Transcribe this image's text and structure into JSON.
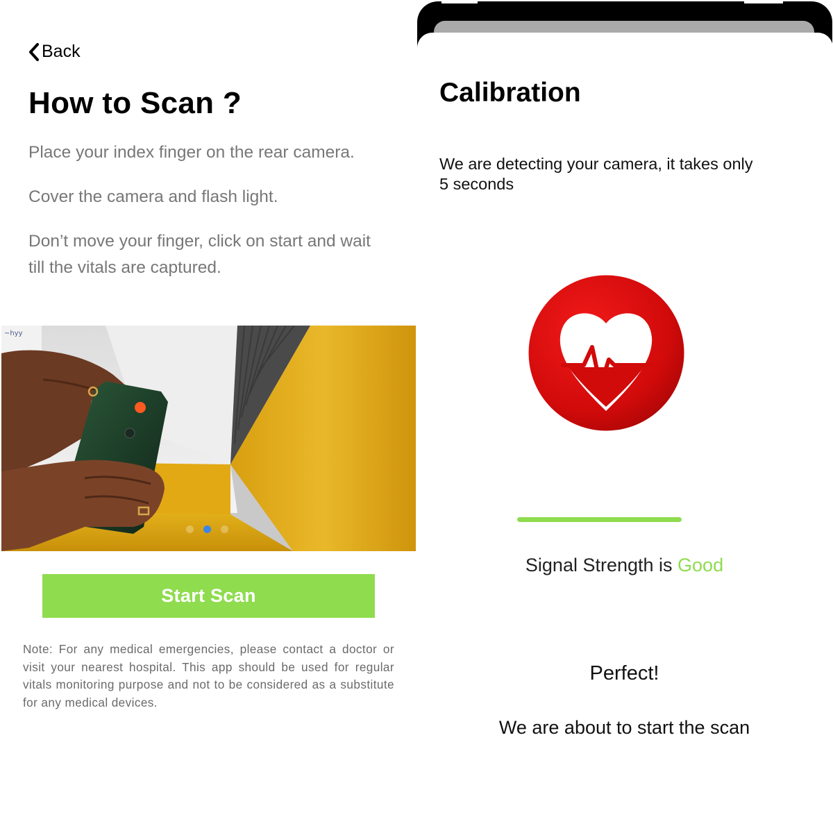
{
  "left": {
    "back_label": "Back",
    "title": "How to Scan ?",
    "instructions": [
      "Place your index finger on the rear camera.",
      "Cover the camera and flash light.",
      "Don’t move your finger, click on start and wait till the vitals are captured."
    ],
    "carousel": {
      "count": 3,
      "active_index": 1
    },
    "start_button_label": "Start Scan",
    "note": "Note: For any medical emergencies, please contact a doctor or visit your nearest hospital. This app should be used for regular vitals monitoring purpose and not to be considered as a substitute for any medical devices."
  },
  "right": {
    "title": "Calibration",
    "subtitle": "We are detecting your camera, it takes only 5 seconds",
    "progress": 1.0,
    "signal_prefix": "Signal Strength is ",
    "signal_value": "Good",
    "perfect_text": "Perfect!",
    "about_text": "We are about to start the scan"
  },
  "icons": {
    "back": "chevron-left-icon",
    "heart": "heart-pulse-icon"
  },
  "colors": {
    "accent_green": "#8fdc4f",
    "heart_red": "#d80d0d",
    "dot_active": "#3d86e6",
    "muted_text": "#777777"
  }
}
